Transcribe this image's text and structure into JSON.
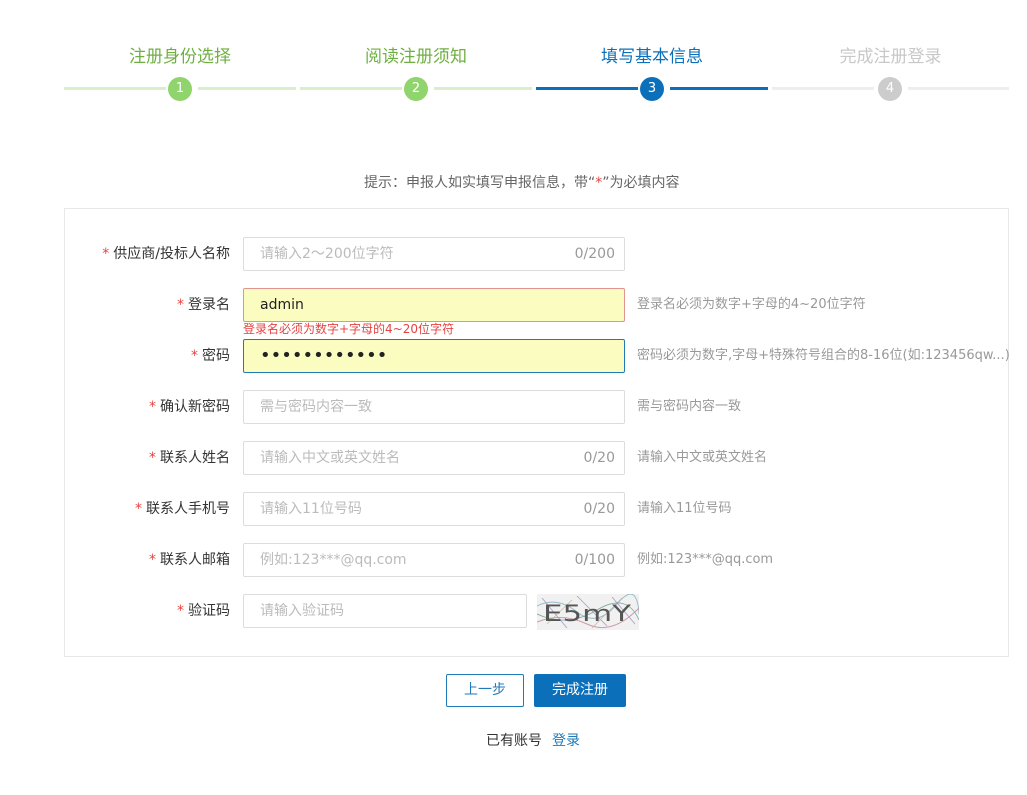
{
  "steps": [
    {
      "title": "注册身份选择",
      "num": "1",
      "state": "done"
    },
    {
      "title": "阅读注册须知",
      "num": "2",
      "state": "done"
    },
    {
      "title": "填写基本信息",
      "num": "3",
      "state": "active"
    },
    {
      "title": "完成注册登录",
      "num": "4",
      "state": "todo"
    }
  ],
  "colors": {
    "done": "#8fd46c",
    "done_text": "#6fb043",
    "done_line": "#d9efcc",
    "active": "#0b6fba",
    "todo": "#cccccc",
    "todo_text": "#c8c8c8",
    "todo_line": "#eeeeee",
    "required": "#e64340"
  },
  "hint": {
    "before": "提示：申报人如实填写申报信息，带“",
    "star": "*",
    "after": "”为必填内容"
  },
  "form": {
    "supplier": {
      "req": "*",
      "label": "供应商/投标人名称",
      "placeholder": "请输入2～200位字符",
      "counter": "0/200"
    },
    "login": {
      "req": "*",
      "label": "登录名",
      "value": "admin",
      "tip": "登录名必须为数字+字母的4~20位字符",
      "error": "登录名必须为数字+字母的4~20位字符"
    },
    "password": {
      "req": "*",
      "label": "密码",
      "value": "••••••••••••",
      "tip": "密码必须为数字,字母+特殊符号组合的8-16位(如:123456qw...)"
    },
    "confirm": {
      "req": "*",
      "label": "确认新密码",
      "placeholder": "需与密码内容一致",
      "tip": "需与密码内容一致"
    },
    "contact_name": {
      "req": "*",
      "label": "联系人姓名",
      "placeholder": "请输入中文或英文姓名",
      "counter": "0/20",
      "tip": "请输入中文或英文姓名"
    },
    "contact_phone": {
      "req": "*",
      "label": "联系人手机号",
      "placeholder": "请输入11位号码",
      "counter": "0/20",
      "tip": "请输入11位号码"
    },
    "contact_email": {
      "req": "*",
      "label": "联系人邮箱",
      "placeholder": "例如:123***@qq.com",
      "counter": "0/100",
      "tip": "例如:123***@qq.com"
    },
    "captcha": {
      "req": "*",
      "label": "验证码",
      "placeholder": "请输入验证码",
      "image_text": "E5mY"
    }
  },
  "buttons": {
    "prev": "上一步",
    "finish": "完成注册"
  },
  "footer": {
    "text": "已有账号",
    "login_link": "登录"
  }
}
